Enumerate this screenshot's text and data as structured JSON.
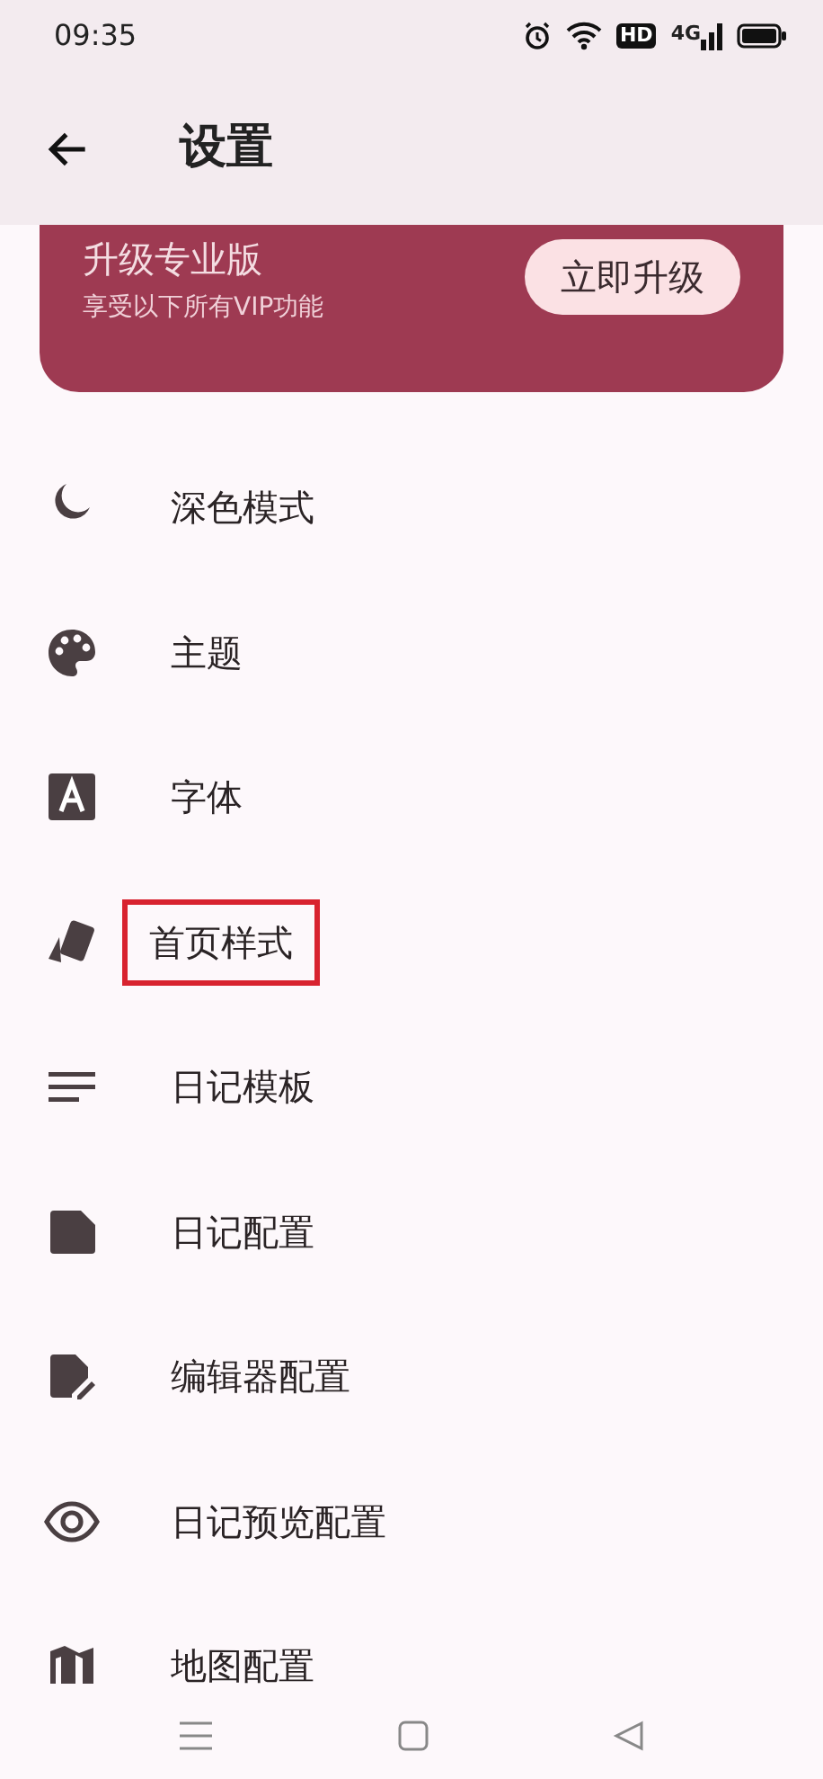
{
  "status_bar": {
    "time": "09:35",
    "hd": "HD",
    "network": "4G"
  },
  "app_bar": {
    "title": "设置"
  },
  "upgrade_banner": {
    "title": "升级专业版",
    "subtitle": "享受以下所有VIP功能",
    "button": "立即升级"
  },
  "settings": [
    {
      "label": "深色模式",
      "highlighted": false
    },
    {
      "label": "主题",
      "highlighted": false
    },
    {
      "label": "字体",
      "highlighted": false
    },
    {
      "label": "首页样式",
      "highlighted": true
    },
    {
      "label": "日记模板",
      "highlighted": false
    },
    {
      "label": "日记配置",
      "highlighted": false
    },
    {
      "label": "编辑器配置",
      "highlighted": false
    },
    {
      "label": "日记预览配置",
      "highlighted": false
    },
    {
      "label": "地图配置",
      "highlighted": false
    }
  ]
}
